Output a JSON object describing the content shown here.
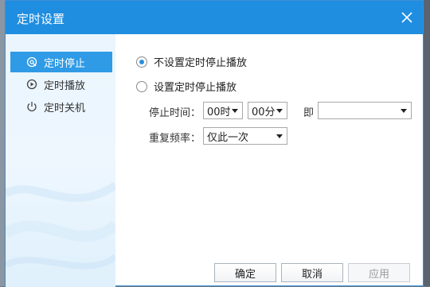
{
  "window": {
    "title": "定时设置"
  },
  "sidebar": {
    "items": [
      {
        "label": "定时停止",
        "icon": "stop-timer-icon",
        "active": true
      },
      {
        "label": "定时播放",
        "icon": "play-timer-icon",
        "active": false
      },
      {
        "label": "定时关机",
        "icon": "power-icon",
        "active": false
      }
    ]
  },
  "options": {
    "no_stop_label": "不设置定时停止播放",
    "set_stop_label": "设置定时停止播放",
    "selected": "no_stop"
  },
  "stop_time": {
    "label": "停止时间：",
    "hour": "00时",
    "minute": "00分",
    "connector": "即",
    "result": ""
  },
  "repeat": {
    "label": "重复频率：",
    "value": "仅此一次"
  },
  "buttons": {
    "ok": "确定",
    "cancel": "取消",
    "apply": "应用"
  },
  "colors": {
    "accent": "#1f8ee0",
    "active_nav": "#2f9be6"
  }
}
